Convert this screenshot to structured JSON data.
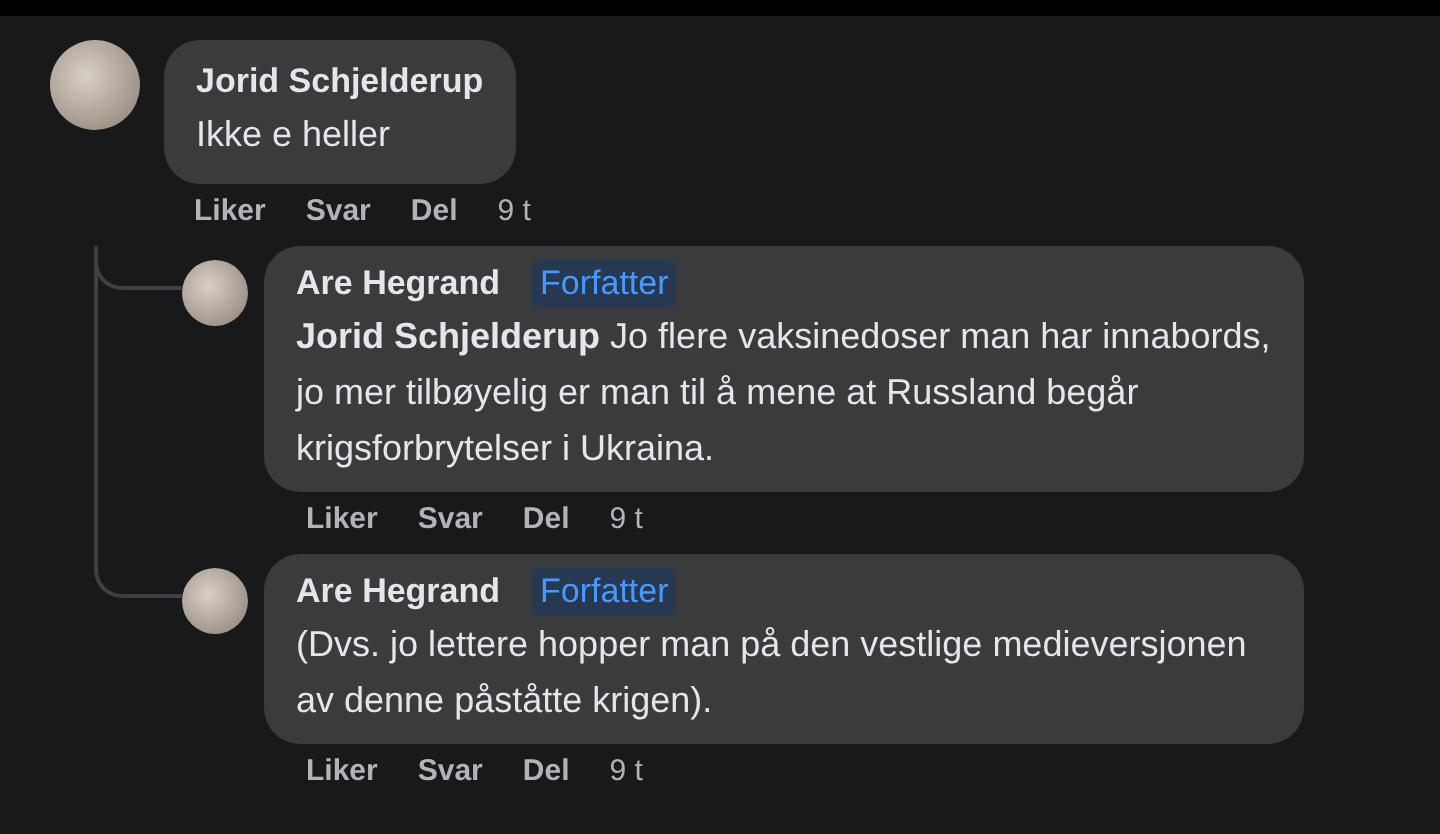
{
  "comments": [
    {
      "author": "Jorid Schjelderup",
      "text": "Ikke e heller",
      "actions": [
        "Liker",
        "Svar",
        "Del"
      ],
      "time": "9 t",
      "replies": [
        {
          "author": "Are Hegrand",
          "badge": "Forfatter",
          "text": "**Jorid Schjelderup** Jo flere vaksinedoser man har innabords, jo mer tilbøyelig er man til å mene at Russland begår krigsforbrytelser i Ukraina.",
          "actions": [
            "Liker",
            "Svar",
            "Del"
          ],
          "time": "9 t"
        },
        {
          "author": "Are Hegrand",
          "badge": "Forfatter",
          "text": "(Dvs. jo lettere hopper man på den vestlige medieversjonen av denne påståtte krigen).",
          "actions": [
            "Liker",
            "Svar",
            "Del"
          ],
          "time": "9 t"
        }
      ]
    }
  ]
}
